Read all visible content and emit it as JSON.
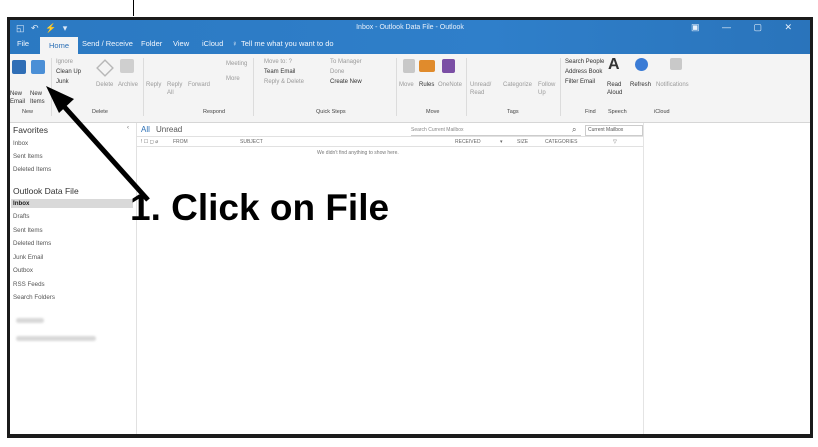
{
  "titlebar": {
    "title": "Inbox - Outlook Data File - Outlook"
  },
  "tabs": [
    "File",
    "Home",
    "Send / Receive",
    "Folder",
    "View",
    "iCloud"
  ],
  "tell_me": "Tell me what you want to do",
  "ribbon": {
    "new_email": "New Email",
    "new_items": "New Items",
    "ignore": "Ignore",
    "clean_up": "Clean Up",
    "junk": "Junk",
    "delete": "Delete",
    "archive": "Archive",
    "reply": "Reply",
    "reply_all": "Reply All",
    "forward": "Forward",
    "meeting": "Meeting",
    "more": "More",
    "move_to": "Move to: ?",
    "team_email": "Team Email",
    "reply_delete": "Reply & Delete",
    "to_manager": "To Manager",
    "done": "Done",
    "create_new": "Create New",
    "move": "Move",
    "rules": "Rules",
    "onenote": "OneNote",
    "unread_read": "Unread/ Read",
    "categorize": "Categorize",
    "follow_up": "Follow Up",
    "search_people": "Search People",
    "address_book": "Address Book",
    "filter_email": "Filter Email",
    "read_aloud": "Read Aloud",
    "refresh": "Refresh",
    "notifications": "Notifications",
    "groups": {
      "new": "New",
      "delete": "Delete",
      "respond": "Respond",
      "quick_steps": "Quick Steps",
      "move": "Move",
      "tags": "Tags",
      "find": "Find",
      "speech": "Speech",
      "icloud": "iCloud"
    }
  },
  "nav": {
    "favorites": "Favorites",
    "fav_items": [
      "Inbox",
      "Sent Items",
      "Deleted Items"
    ],
    "datafile": "Outlook Data File",
    "folders": [
      "Inbox",
      "Drafts",
      "Sent Items",
      "Deleted Items",
      "Junk Email",
      "Outbox",
      "RSS Feeds",
      "Search Folders"
    ]
  },
  "mail": {
    "filter_all": "All",
    "filter_unread": "Unread",
    "search_placeholder": "Search Current Mailbox",
    "scope": "Current Mailbox",
    "columns": {
      "from": "FROM",
      "subject": "SUBJECT",
      "received": "RECEIVED",
      "size": "SIZE",
      "categories": "CATEGORIES"
    },
    "empty": "We didn't find anything to show here."
  },
  "annotation": "1. Click on File"
}
